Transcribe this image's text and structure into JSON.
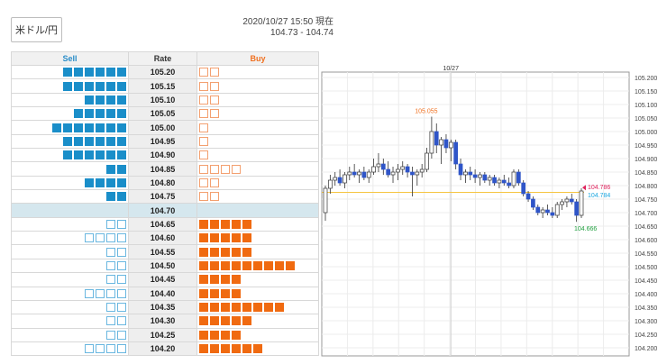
{
  "pair_label": "米ドル/円",
  "quote": {
    "timestamp": "2020/10/27 15:50 現在",
    "range": "104.73 - 104.74"
  },
  "book_headers": {
    "sell": "Sell",
    "rate": "Rate",
    "buy": "Buy"
  },
  "book_rows": [
    {
      "rate": "105.20",
      "sell": {
        "filled": 6,
        "outlined": 0
      },
      "buy": {
        "filled": 0,
        "outlined": 2
      }
    },
    {
      "rate": "105.15",
      "sell": {
        "filled": 6,
        "outlined": 0
      },
      "buy": {
        "filled": 0,
        "outlined": 2
      }
    },
    {
      "rate": "105.10",
      "sell": {
        "filled": 4,
        "outlined": 0
      },
      "buy": {
        "filled": 0,
        "outlined": 2
      }
    },
    {
      "rate": "105.05",
      "sell": {
        "filled": 5,
        "outlined": 0
      },
      "buy": {
        "filled": 0,
        "outlined": 2
      }
    },
    {
      "rate": "105.00",
      "sell": {
        "filled": 7,
        "outlined": 0
      },
      "buy": {
        "filled": 0,
        "outlined": 1
      }
    },
    {
      "rate": "104.95",
      "sell": {
        "filled": 6,
        "outlined": 0
      },
      "buy": {
        "filled": 0,
        "outlined": 1
      }
    },
    {
      "rate": "104.90",
      "sell": {
        "filled": 6,
        "outlined": 0
      },
      "buy": {
        "filled": 0,
        "outlined": 1
      }
    },
    {
      "rate": "104.85",
      "sell": {
        "filled": 2,
        "outlined": 0
      },
      "buy": {
        "filled": 0,
        "outlined": 4
      }
    },
    {
      "rate": "104.80",
      "sell": {
        "filled": 4,
        "outlined": 0
      },
      "buy": {
        "filled": 0,
        "outlined": 2
      }
    },
    {
      "rate": "104.75",
      "sell": {
        "filled": 2,
        "outlined": 0
      },
      "buy": {
        "filled": 0,
        "outlined": 2
      }
    },
    {
      "rate": "104.70",
      "sell": {
        "filled": 0,
        "outlined": 0
      },
      "buy": {
        "filled": 0,
        "outlined": 0
      },
      "current": true
    },
    {
      "rate": "104.65",
      "sell": {
        "filled": 0,
        "outlined": 2
      },
      "buy": {
        "filled": 5,
        "outlined": 0
      }
    },
    {
      "rate": "104.60",
      "sell": {
        "filled": 0,
        "outlined": 4
      },
      "buy": {
        "filled": 5,
        "outlined": 0
      }
    },
    {
      "rate": "104.55",
      "sell": {
        "filled": 0,
        "outlined": 2
      },
      "buy": {
        "filled": 5,
        "outlined": 0
      }
    },
    {
      "rate": "104.50",
      "sell": {
        "filled": 0,
        "outlined": 2
      },
      "buy": {
        "filled": 9,
        "outlined": 0
      }
    },
    {
      "rate": "104.45",
      "sell": {
        "filled": 0,
        "outlined": 2
      },
      "buy": {
        "filled": 4,
        "outlined": 0
      }
    },
    {
      "rate": "104.40",
      "sell": {
        "filled": 0,
        "outlined": 4
      },
      "buy": {
        "filled": 4,
        "outlined": 0
      }
    },
    {
      "rate": "104.35",
      "sell": {
        "filled": 0,
        "outlined": 2
      },
      "buy": {
        "filled": 8,
        "outlined": 0
      }
    },
    {
      "rate": "104.30",
      "sell": {
        "filled": 0,
        "outlined": 2
      },
      "buy": {
        "filled": 5,
        "outlined": 0
      }
    },
    {
      "rate": "104.25",
      "sell": {
        "filled": 0,
        "outlined": 2
      },
      "buy": {
        "filled": 4,
        "outlined": 0
      }
    },
    {
      "rate": "104.20",
      "sell": {
        "filled": 0,
        "outlined": 4
      },
      "buy": {
        "filled": 6,
        "outlined": 0
      }
    }
  ],
  "colors": {
    "sell": "#1a8ec9",
    "buy": "#f06a10",
    "bull": "#ffffff",
    "bear": "#2f55c8",
    "current_line": "#f5c542",
    "bid": "#e0245e",
    "ask": "#1aa6e0",
    "high": "#f07020",
    "low": "#22a040"
  },
  "chart_data": {
    "type": "candlestick",
    "x_label": "10/27",
    "ylim": [
      104.17,
      105.22
    ],
    "y_ticks": [
      "105.200",
      "105.150",
      "105.100",
      "105.050",
      "105.000",
      "104.950",
      "104.900",
      "104.850",
      "104.800",
      "104.750",
      "104.700",
      "104.650",
      "104.600",
      "104.550",
      "104.500",
      "104.450",
      "104.400",
      "104.350",
      "104.300",
      "104.250",
      "104.200"
    ],
    "candles": [
      [
        104.7,
        104.8,
        104.67,
        104.79
      ],
      [
        104.79,
        104.84,
        104.77,
        104.82
      ],
      [
        104.82,
        104.85,
        104.8,
        104.83
      ],
      [
        104.83,
        104.86,
        104.8,
        104.81
      ],
      [
        104.81,
        104.85,
        104.79,
        104.84
      ],
      [
        104.84,
        104.87,
        104.82,
        104.85
      ],
      [
        104.85,
        104.88,
        104.83,
        104.84
      ],
      [
        104.84,
        104.86,
        104.81,
        104.85
      ],
      [
        104.85,
        104.87,
        104.82,
        104.83
      ],
      [
        104.83,
        104.86,
        104.81,
        104.85
      ],
      [
        104.85,
        104.9,
        104.84,
        104.87
      ],
      [
        104.87,
        104.92,
        104.85,
        104.88
      ],
      [
        104.88,
        104.9,
        104.84,
        104.86
      ],
      [
        104.86,
        104.89,
        104.83,
        104.84
      ],
      [
        104.84,
        104.87,
        104.81,
        104.85
      ],
      [
        104.85,
        104.88,
        104.82,
        104.86
      ],
      [
        104.86,
        104.89,
        104.84,
        104.87
      ],
      [
        104.87,
        104.88,
        104.83,
        104.85
      ],
      [
        104.85,
        104.87,
        104.76,
        104.84
      ],
      [
        104.84,
        104.86,
        104.8,
        104.85
      ],
      [
        104.85,
        104.88,
        104.83,
        104.86
      ],
      [
        104.86,
        104.94,
        104.85,
        104.92
      ],
      [
        104.92,
        105.055,
        104.9,
        105.0
      ],
      [
        105.0,
        105.03,
        104.92,
        104.95
      ],
      [
        104.95,
        104.98,
        104.88,
        104.97
      ],
      [
        104.97,
        104.99,
        104.92,
        104.94
      ],
      [
        104.94,
        104.97,
        104.89,
        104.96
      ],
      [
        104.96,
        104.97,
        104.86,
        104.88
      ],
      [
        104.88,
        104.9,
        104.82,
        104.84
      ],
      [
        104.84,
        104.86,
        104.81,
        104.85
      ],
      [
        104.85,
        104.87,
        104.82,
        104.84
      ],
      [
        104.84,
        104.86,
        104.81,
        104.83
      ],
      [
        104.83,
        104.85,
        104.8,
        104.84
      ],
      [
        104.84,
        104.85,
        104.81,
        104.82
      ],
      [
        104.82,
        104.84,
        104.8,
        104.83
      ],
      [
        104.83,
        104.84,
        104.8,
        104.81
      ],
      [
        104.81,
        104.83,
        104.79,
        104.82
      ],
      [
        104.82,
        104.84,
        104.8,
        104.81
      ],
      [
        104.81,
        104.83,
        104.79,
        104.8
      ],
      [
        104.8,
        104.86,
        104.79,
        104.85
      ],
      [
        104.85,
        104.86,
        104.8,
        104.81
      ],
      [
        104.81,
        104.82,
        104.76,
        104.77
      ],
      [
        104.77,
        104.78,
        104.74,
        104.75
      ],
      [
        104.75,
        104.76,
        104.71,
        104.72
      ],
      [
        104.72,
        104.73,
        104.69,
        104.7
      ],
      [
        104.7,
        104.72,
        104.68,
        104.71
      ],
      [
        104.71,
        104.73,
        104.69,
        104.7
      ],
      [
        104.7,
        104.72,
        104.68,
        104.69
      ],
      [
        104.69,
        104.74,
        104.68,
        104.73
      ],
      [
        104.73,
        104.75,
        104.71,
        104.74
      ],
      [
        104.74,
        104.76,
        104.72,
        104.75
      ],
      [
        104.75,
        104.77,
        104.73,
        104.74
      ],
      [
        104.74,
        104.75,
        104.666,
        104.69
      ],
      [
        104.69,
        104.79,
        104.68,
        104.78
      ]
    ],
    "current_line": 104.775,
    "annotations": {
      "high": "105.055",
      "low": "104.666",
      "bid": "104.786",
      "ask": "104.784"
    }
  }
}
